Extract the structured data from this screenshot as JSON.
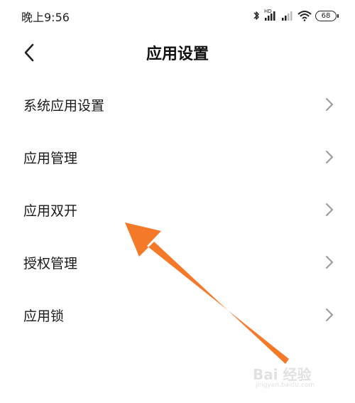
{
  "status_bar": {
    "time": "晚上9:56",
    "battery": "68",
    "hd_badge": "HD"
  },
  "header": {
    "title": "应用设置"
  },
  "settings": {
    "items": [
      {
        "label": "系统应用设置"
      },
      {
        "label": "应用管理"
      },
      {
        "label": "应用双开"
      },
      {
        "label": "授权管理"
      },
      {
        "label": "应用锁"
      }
    ]
  },
  "watermark": {
    "logo": "Bai 经验",
    "url": "jingyan.baidu.com"
  },
  "colors": {
    "arrow": "#f47a2a",
    "text": "#1a1a1a",
    "chevron": "#9a9a9a"
  }
}
